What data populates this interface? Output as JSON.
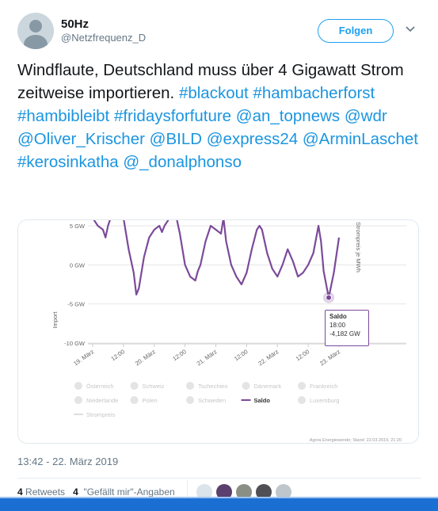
{
  "user": {
    "name": "50Hz",
    "handle": "@Netzfrequenz_D",
    "follow_label": "Folgen"
  },
  "tweet": {
    "text": "Windflaute, Deutschland muss über 4 Gigawatt Strom zeitweise importieren.",
    "tags": [
      "#blackout",
      "#hambacherforst",
      "#hambibleibt",
      "#fridaysforfuture",
      "@an_topnews",
      "@wdr",
      "@Oliver_Krischer",
      "@BILD",
      "@express24",
      "@ArminLaschet",
      "#kerosinkatha",
      "@_donalphonso"
    ]
  },
  "chart_data": {
    "type": "line",
    "ylabel": "Import",
    "y2label": "Strompreis je MWh",
    "yticks": [
      "5 GW",
      "0 GW",
      "-5 GW",
      "-10 GW"
    ],
    "ylim": [
      -10,
      5
    ],
    "xticks": [
      "19. März",
      "12:00",
      "20. März",
      "12:00",
      "21. März",
      "12:00",
      "22. März",
      "12:00",
      "23. März"
    ],
    "series": [
      {
        "name": "Saldo",
        "color": "#7b4a9a",
        "x_hours": [
          0,
          2,
          4,
          5,
          6,
          8,
          10,
          12,
          14,
          16,
          17,
          18,
          20,
          22,
          24,
          26,
          27,
          28,
          30,
          32,
          34,
          36,
          38,
          40,
          41,
          42,
          44,
          46,
          48,
          50,
          51,
          52,
          54,
          56,
          58,
          60,
          62,
          64,
          65,
          66,
          68,
          70,
          72,
          74,
          76,
          78,
          80,
          82,
          84,
          86,
          88,
          89,
          90,
          92,
          94,
          96
        ],
        "values": [
          6,
          5,
          4.5,
          3.5,
          5,
          7,
          8,
          6,
          2,
          -1,
          -3.8,
          -3,
          1,
          3.5,
          4.5,
          5,
          4.2,
          5,
          6,
          7,
          4,
          0,
          -1.5,
          -2,
          -0.8,
          0,
          3,
          5,
          4.5,
          4,
          6,
          3,
          0,
          -1.5,
          -2.5,
          -1,
          2,
          4.5,
          5,
          4.5,
          1.5,
          -0.5,
          -1.5,
          0,
          2,
          0.5,
          -1.5,
          -1,
          0,
          1.5,
          5,
          3,
          -0.8,
          -4.18,
          -1,
          3.5
        ]
      }
    ],
    "tooltip": {
      "series": "Saldo",
      "time": "18:00",
      "value": "-4,182 GW"
    },
    "legend": [
      "Österreich",
      "Schweiz",
      "Tschechien",
      "Dänemark",
      "Frankreich",
      "Niederlande",
      "Polen",
      "Schweden",
      "Saldo",
      "Luxemburg",
      "Strompreis"
    ],
    "active_series": "Saldo",
    "credit": "Agora Energiewende; Stand: 22.03.2019, 21:20",
    "grid": true
  },
  "meta": {
    "timestamp": "13:42 - 22. März 2019",
    "retweets_count": "4",
    "retweets_label": "Retweets",
    "likes_count": "4",
    "likes_label": "\"Gefällt mir\"-Angaben"
  }
}
